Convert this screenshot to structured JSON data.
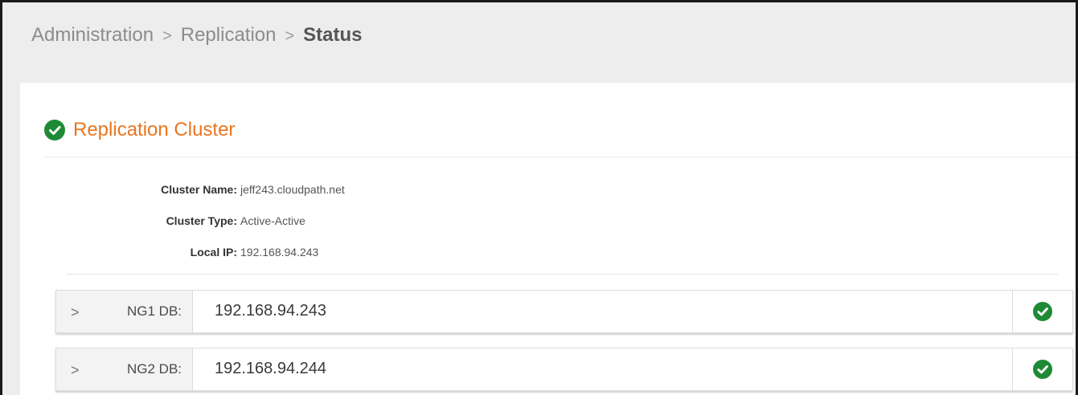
{
  "breadcrumb": {
    "items": [
      "Administration",
      "Replication"
    ],
    "separator": ">",
    "current": "Status"
  },
  "section": {
    "title": "Replication Cluster",
    "status_icon": "check-circle-icon",
    "status_color": "#1f8a35",
    "title_color": "#e8761f"
  },
  "cluster": {
    "name_label": "Cluster Name:",
    "name_value": "jeff243.cloudpath.net",
    "type_label": "Cluster Type:",
    "type_value": "Active-Active",
    "ip_label": "Local IP:",
    "ip_value": "192.168.94.243"
  },
  "databases": [
    {
      "label": "NG1 DB:",
      "ip": "192.168.94.243",
      "status": "ok",
      "expand_icon": ">"
    },
    {
      "label": "NG2 DB:",
      "ip": "192.168.94.244",
      "status": "ok",
      "expand_icon": ">"
    }
  ]
}
